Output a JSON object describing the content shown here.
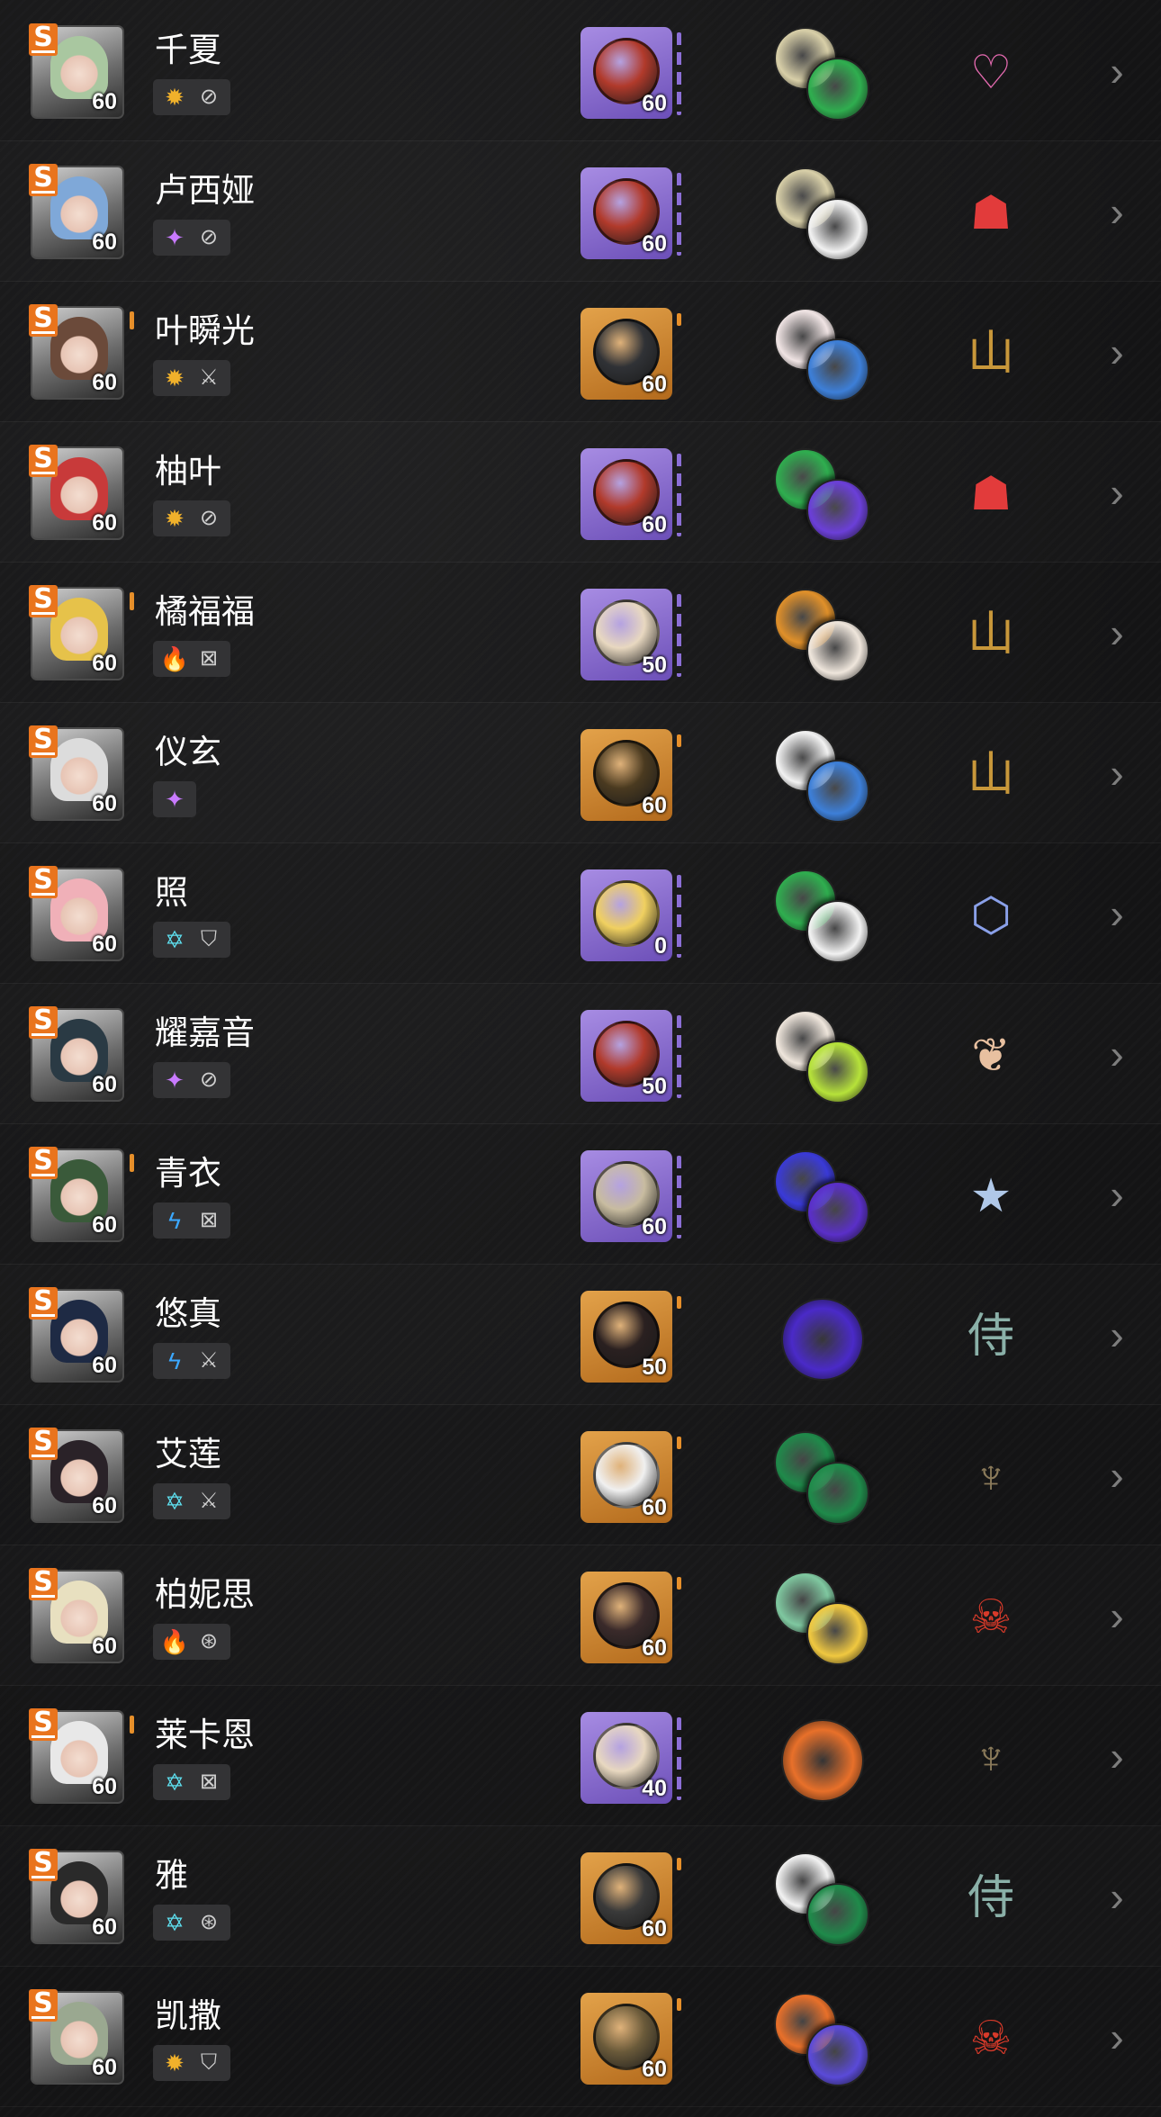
{
  "agents": [
    {
      "name": "千夏",
      "level": "60",
      "rank": "S",
      "hair": "#a9c7a0",
      "attribute_icon": "physical-icon",
      "specialty_icon": "support-icon",
      "engine": {
        "level": "60",
        "rarity": "A",
        "color": "#b13a2b",
        "mark": "none"
      },
      "discs": [
        {
          "icon": "disc-puffer-electro-icon",
          "color": "#d8cfa8"
        },
        {
          "icon": "disc-swing-jazz-icon",
          "color": "#2fae4f"
        }
      ],
      "faction": {
        "icon": "angels-of-delusion-icon",
        "glyph": "♡",
        "color": "#e76bb2"
      },
      "marked": false
    },
    {
      "name": "卢西娅",
      "level": "60",
      "rank": "S",
      "hair": "#7fa8d8",
      "attribute_icon": "ether-icon",
      "specialty_icon": "support-icon",
      "engine": {
        "level": "60",
        "rarity": "A",
        "color": "#b13a2b",
        "mark": "none"
      },
      "discs": [
        {
          "icon": "disc-puffer-electro-icon",
          "color": "#d8cfa8"
        },
        {
          "icon": "disc-yunkui-icon",
          "color": "#f2f2f2"
        }
      ],
      "faction": {
        "icon": "spook-shack-icon",
        "glyph": "☗",
        "color": "#e23b3b"
      },
      "marked": false
    },
    {
      "name": "叶瞬光",
      "level": "60",
      "rank": "S",
      "hair": "#6b4a3a",
      "attribute_icon": "physical-icon",
      "specialty_icon": "attack-icon",
      "engine": {
        "level": "60",
        "rarity": "S",
        "color": "#303236",
        "mark": "orange"
      },
      "discs": [
        {
          "icon": "disc-dawn-bloom-icon",
          "color": "#f0e4e4"
        },
        {
          "icon": "disc-shadow-harmony-icon",
          "color": "#3d7fd8"
        }
      ],
      "faction": {
        "icon": "yunkui-summit-icon",
        "glyph": "山",
        "color": "#c8973a"
      },
      "marked": true
    },
    {
      "name": "柚叶",
      "level": "60",
      "rank": "S",
      "hair": "#c83a3a",
      "attribute_icon": "physical-icon",
      "specialty_icon": "support-icon",
      "engine": {
        "level": "60",
        "rarity": "A",
        "color": "#b13a2b",
        "mark": "none"
      },
      "discs": [
        {
          "icon": "disc-swing-jazz-icon",
          "color": "#2fae4f"
        },
        {
          "icon": "disc-astral-voice-icon",
          "color": "#6b3fd8"
        }
      ],
      "faction": {
        "icon": "spook-shack-icon",
        "glyph": "☗",
        "color": "#e23b3b"
      },
      "marked": false
    },
    {
      "name": "橘福福",
      "level": "60",
      "rank": "S",
      "hair": "#e6c24a",
      "attribute_icon": "fire-icon",
      "specialty_icon": "stun-icon",
      "engine": {
        "level": "50",
        "rarity": "A",
        "color": "#e8d8c0",
        "mark": "none"
      },
      "discs": [
        {
          "icon": "disc-shockstar-disco-icon",
          "color": "#e0902a"
        },
        {
          "icon": "disc-fanged-metal-icon",
          "color": "#efe6dc"
        }
      ],
      "faction": {
        "icon": "yunkui-summit-icon",
        "glyph": "山",
        "color": "#c8973a"
      },
      "marked": true
    },
    {
      "name": "仪玄",
      "level": "60",
      "rank": "S",
      "hair": "#dcdcdc",
      "attribute_icon": "ether-icon",
      "specialty_icon": "none",
      "engine": {
        "level": "60",
        "rarity": "S",
        "color": "#4a3a20",
        "mark": "orange"
      },
      "discs": [
        {
          "icon": "disc-yunkui-icon",
          "color": "#f2f2f2"
        },
        {
          "icon": "disc-shadow-harmony-icon",
          "color": "#3d7fd8"
        }
      ],
      "faction": {
        "icon": "yunkui-summit-icon",
        "glyph": "山",
        "color": "#c8973a"
      },
      "marked": false
    },
    {
      "name": "照",
      "level": "60",
      "rank": "S",
      "hair": "#f0b0b8",
      "attribute_icon": "ice-icon",
      "specialty_icon": "defense-icon",
      "engine": {
        "level": "0",
        "rarity": "A",
        "color": "#f0d060",
        "mark": "none"
      },
      "discs": [
        {
          "icon": "disc-swing-jazz-icon",
          "color": "#2fae4f"
        },
        {
          "icon": "disc-yunkui-icon",
          "color": "#f2f2f2"
        }
      ],
      "faction": {
        "icon": "krampus-icon",
        "glyph": "⬡",
        "color": "#8aa0e8"
      },
      "marked": false
    },
    {
      "name": "耀嘉音",
      "level": "60",
      "rank": "S",
      "hair": "#2a3a44",
      "attribute_icon": "ether-icon",
      "specialty_icon": "support-icon",
      "engine": {
        "level": "50",
        "rarity": "A",
        "color": "#b13a2b",
        "mark": "none"
      },
      "discs": [
        {
          "icon": "disc-fanged-metal-icon",
          "color": "#efe6dc"
        },
        {
          "icon": "disc-two-icon",
          "color": "#b6e23a"
        }
      ],
      "faction": {
        "icon": "mockingbird-icon",
        "glyph": "❦",
        "color": "#e8c0a0"
      },
      "marked": false
    },
    {
      "name": "青衣",
      "level": "60",
      "rank": "S",
      "hair": "#3a5a3a",
      "attribute_icon": "electric-icon",
      "specialty_icon": "stun-icon",
      "engine": {
        "level": "60",
        "rarity": "A",
        "color": "#c8bca0",
        "mark": "none"
      },
      "discs": [
        {
          "icon": "disc-astral-stars-icon",
          "color": "#3a3ad8"
        },
        {
          "icon": "disc-astral-voice-icon",
          "color": "#5a2fc8"
        }
      ],
      "faction": {
        "icon": "section-6-icon",
        "glyph": "★",
        "color": "#b0c8e8"
      },
      "marked": true
    },
    {
      "name": "悠真",
      "level": "60",
      "rank": "S",
      "hair": "#1e2a44",
      "attribute_icon": "electric-icon",
      "specialty_icon": "attack-icon",
      "engine": {
        "level": "50",
        "rarity": "S",
        "color": "#2a2020",
        "mark": "orange"
      },
      "discs": [
        {
          "icon": "disc-astral-voice-icon",
          "color": "#4a2ac8"
        }
      ],
      "faction": {
        "icon": "hsos6-icon",
        "glyph": "侍",
        "color": "#8ab0a8"
      },
      "marked": false
    },
    {
      "name": "艾莲",
      "level": "60",
      "rank": "S",
      "hair": "#2a2228",
      "attribute_icon": "ice-icon",
      "specialty_icon": "attack-icon",
      "engine": {
        "level": "60",
        "rarity": "S",
        "color": "#f0f0f0",
        "mark": "orange"
      },
      "discs": [
        {
          "icon": "disc-woodpecker-icon",
          "color": "#1f8a4a"
        },
        {
          "icon": "disc-oxo-icon",
          "color": "#1f8a4a"
        }
      ],
      "faction": {
        "icon": "victoria-housekeeping-icon",
        "glyph": "♆",
        "color": "#8a7a5a"
      },
      "marked": false
    },
    {
      "name": "柏妮思",
      "level": "60",
      "rank": "S",
      "hair": "#e8e0c0",
      "attribute_icon": "fire-icon",
      "specialty_icon": "anomaly-icon",
      "engine": {
        "level": "60",
        "rarity": "S",
        "color": "#3a2a2a",
        "mark": "none"
      },
      "discs": [
        {
          "icon": "disc-freedom-blues-icon",
          "color": "#7fc8a0"
        },
        {
          "icon": "disc-chaos-jazz-icon",
          "color": "#f0c840"
        }
      ],
      "faction": {
        "icon": "sons-of-calydon-icon",
        "glyph": "☠",
        "color": "#d83a2a"
      },
      "marked": false
    },
    {
      "name": "莱卡恩",
      "level": "60",
      "rank": "S",
      "hair": "#e8e8e8",
      "attribute_icon": "ice-icon",
      "specialty_icon": "stun-icon",
      "engine": {
        "level": "40",
        "rarity": "A",
        "color": "#e8d8c0",
        "mark": "none"
      },
      "discs": [
        {
          "icon": "disc-inferno-metal-icon",
          "color": "#e8702a"
        }
      ],
      "faction": {
        "icon": "victoria-housekeeping-icon",
        "glyph": "♆",
        "color": "#8a7a5a"
      },
      "marked": true
    },
    {
      "name": "雅",
      "level": "60",
      "rank": "S",
      "hair": "#2a2a2a",
      "attribute_icon": "ice-icon",
      "specialty_icon": "anomaly-icon",
      "engine": {
        "level": "60",
        "rarity": "S",
        "color": "#3a3a3a",
        "mark": "orange"
      },
      "discs": [
        {
          "icon": "disc-shadow-harmony-icon",
          "color": "#f2f2f2"
        },
        {
          "icon": "disc-oxo-icon",
          "color": "#1f8a4a"
        }
      ],
      "faction": {
        "icon": "hsos6-icon",
        "glyph": "侍",
        "color": "#8ab0a8"
      },
      "marked": false
    },
    {
      "name": "凯撒",
      "level": "60",
      "rank": "S",
      "hair": "#9aa890",
      "attribute_icon": "physical-icon",
      "specialty_icon": "defense-icon",
      "engine": {
        "level": "60",
        "rarity": "S",
        "color": "#6a5a3a",
        "mark": "orange"
      },
      "discs": [
        {
          "icon": "disc-inferno-metal-icon",
          "color": "#e8702a"
        },
        {
          "icon": "disc-astral-stars-icon",
          "color": "#5a4ad8"
        }
      ],
      "faction": {
        "icon": "sons-of-calydon-icon",
        "glyph": "☠",
        "color": "#d83a2a"
      },
      "marked": false
    }
  ],
  "glyphs": {
    "physical-icon": "✹",
    "ether-icon": "✦",
    "fire-icon": "🔥",
    "electric-icon": "ϟ",
    "ice-icon": "✡",
    "support-icon": "⊘",
    "attack-icon": "⚔",
    "stun-icon": "⊠",
    "defense-icon": "⛉",
    "anomaly-icon": "⊛",
    "none": "",
    "chevron": "›"
  }
}
